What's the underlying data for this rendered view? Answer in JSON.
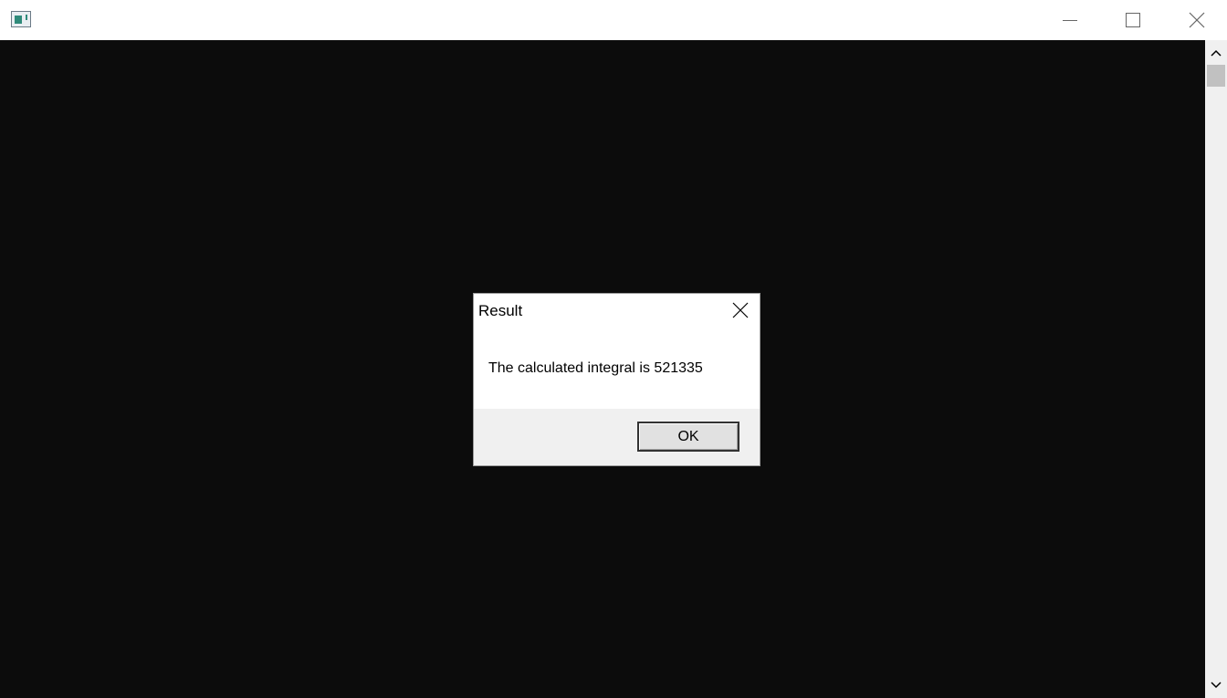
{
  "window": {
    "icon": "console-app-icon",
    "controls": {
      "minimize_icon": "minimize-icon",
      "maximize_icon": "maximize-icon",
      "close_icon": "close-icon"
    },
    "console_background": "#0c0c0c",
    "scrollbar": {
      "up_icon": "chevron-up-icon",
      "down_icon": "chevron-down-icon"
    }
  },
  "dialog": {
    "title": "Result",
    "message": "The calculated integral is 521335",
    "ok_label": "OK",
    "close_icon": "close-icon"
  }
}
